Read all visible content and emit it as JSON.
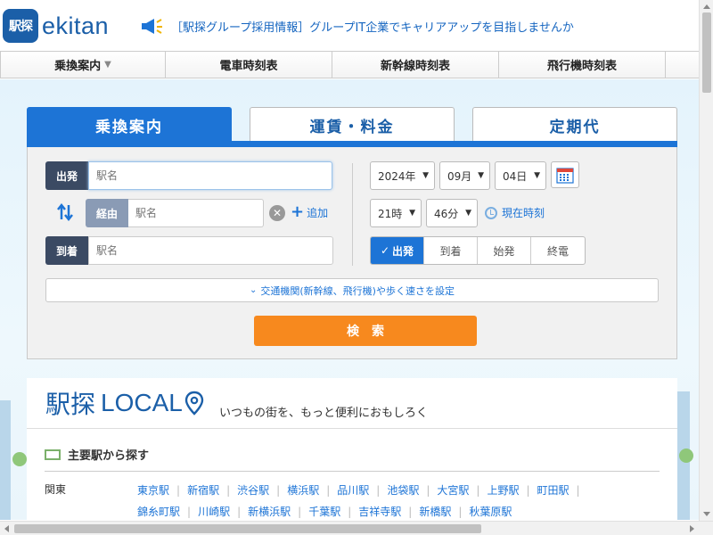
{
  "header": {
    "logo_badge": "駅探",
    "logo_text": "ekitan",
    "promo_text": "［駅探グループ採用情報］グループIT企業でキャリアアップを目指しませんか"
  },
  "nav": {
    "items": [
      {
        "label": "乗換案内"
      },
      {
        "label": "電車時刻表"
      },
      {
        "label": "新幹線時刻表"
      },
      {
        "label": "飛行機時刻表"
      }
    ],
    "caret": "▼"
  },
  "search": {
    "tabs": [
      {
        "label": "乗換案内",
        "active": true
      },
      {
        "label": "運賃・料金",
        "active": false
      },
      {
        "label": "定期代",
        "active": false
      }
    ],
    "depart_label": "出発",
    "depart_placeholder": "駅名",
    "via_label": "経由",
    "via_placeholder": "駅名",
    "arrive_label": "到着",
    "arrive_placeholder": "駅名",
    "add_label": "追加",
    "year": "2024年",
    "month": "09月",
    "day": "04日",
    "hour": "21時",
    "minute": "46分",
    "now_label": "現在時刻",
    "modes": [
      {
        "label": "出発",
        "active": true
      },
      {
        "label": "到着",
        "active": false
      },
      {
        "label": "始発",
        "active": false
      },
      {
        "label": "終電",
        "active": false
      }
    ],
    "options_label": "交通機関(新幹線、飛行機)や歩く速さを設定",
    "submit_label": "検索"
  },
  "local": {
    "title_kanji": "駅探",
    "title_en": "LOCAL",
    "tagline": "いつもの街を、もっと便利におもしろく",
    "section_title": "主要駅から探す",
    "region": "関東",
    "stations": [
      "東京駅",
      "新宿駅",
      "渋谷駅",
      "横浜駅",
      "品川駅",
      "池袋駅",
      "大宮駅",
      "上野駅",
      "町田駅",
      "錦糸町駅",
      "川崎駅",
      "新横浜駅",
      "千葉駅",
      "吉祥寺駅",
      "新橋駅",
      "秋葉原駅"
    ]
  },
  "colors": {
    "brand": "#1b5fa8",
    "accent": "#1d74d6",
    "search_button": "#f7891e",
    "label_dark": "#3b4a63"
  },
  "icons": [
    "megaphone-icon",
    "swap-icon",
    "clear-icon",
    "plus-icon",
    "calendar-icon",
    "clock-icon",
    "chevron-down-icon",
    "map-pin-icon",
    "station-icon"
  ]
}
